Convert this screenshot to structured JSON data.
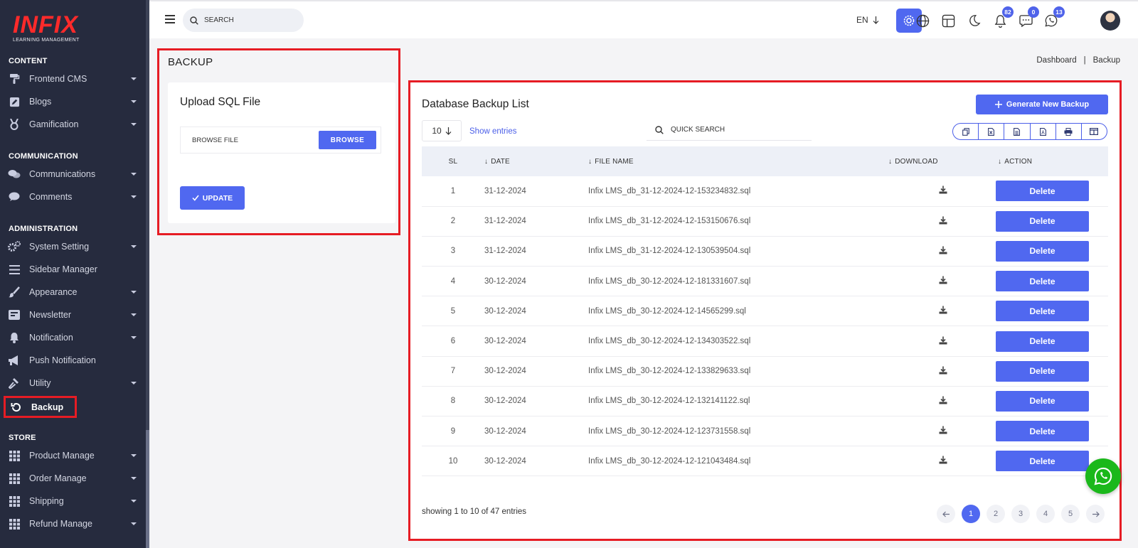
{
  "brand": {
    "name": "INFIX",
    "tagline": "LEARNING MANAGEMENT"
  },
  "sidebar": {
    "sections": [
      {
        "title": "CONTENT",
        "items": [
          {
            "label": "Frontend CMS",
            "icon": "paint-roller-icon",
            "has_caret": true
          },
          {
            "label": "Blogs",
            "icon": "pencil-square-icon",
            "has_caret": true
          },
          {
            "label": "Gamification",
            "icon": "medal-icon",
            "has_caret": true
          }
        ]
      },
      {
        "title": "COMMUNICATION",
        "items": [
          {
            "label": "Communications",
            "icon": "users-chat-icon",
            "has_caret": true
          },
          {
            "label": "Comments",
            "icon": "comment-icon",
            "has_caret": true
          }
        ]
      },
      {
        "title": "ADMINISTRATION",
        "items": [
          {
            "label": "System Setting",
            "icon": "gears-icon",
            "has_caret": true
          },
          {
            "label": "Sidebar Manager",
            "icon": "bars-icon",
            "has_caret": false
          },
          {
            "label": "Appearance",
            "icon": "brush-icon",
            "has_caret": true
          },
          {
            "label": "Newsletter",
            "icon": "newsletter-icon",
            "has_caret": true
          },
          {
            "label": "Notification",
            "icon": "bell-icon",
            "has_caret": true
          },
          {
            "label": "Push Notification",
            "icon": "megaphone-icon",
            "has_caret": false
          },
          {
            "label": "Utility",
            "icon": "hammer-icon",
            "has_caret": true
          },
          {
            "label": "Backup",
            "icon": "restore-icon",
            "has_caret": false,
            "active": true
          }
        ]
      },
      {
        "title": "STORE",
        "items": [
          {
            "label": "Product Manage",
            "icon": "grid-icon",
            "has_caret": true
          },
          {
            "label": "Order Manage",
            "icon": "grid-icon",
            "has_caret": true
          },
          {
            "label": "Shipping",
            "icon": "grid-icon",
            "has_caret": true
          },
          {
            "label": "Refund Manage",
            "icon": "grid-icon",
            "has_caret": true
          }
        ]
      }
    ]
  },
  "header": {
    "search_placeholder": "SEARCH",
    "language": "EN",
    "notification_count": "82",
    "message_count": "0",
    "whatsapp_count": "13"
  },
  "page": {
    "title": "BACKUP",
    "breadcrumb": [
      "Dashboard",
      "|",
      "Backup"
    ]
  },
  "upload": {
    "title": "Upload SQL File",
    "file_placeholder": "BROWSE FILE",
    "browse_label": "BROWSE",
    "update_label": "UPDATE"
  },
  "backup_list": {
    "title": "Database Backup List",
    "generate_label": "Generate New Backup",
    "page_length": "10",
    "show_entries_label": "Show entries",
    "search_placeholder": "QUICK SEARCH",
    "export_buttons": [
      "copy-icon",
      "excel-icon",
      "csv-icon",
      "pdf-icon",
      "print-icon",
      "columns-icon"
    ],
    "columns": [
      "SL",
      "DATE",
      "FILE NAME",
      "DOWNLOAD",
      "ACTION"
    ],
    "delete_label": "Delete",
    "rows": [
      {
        "sl": "1",
        "date": "31-12-2024",
        "file": "Infix LMS_db_31-12-2024-12-153234832.sql"
      },
      {
        "sl": "2",
        "date": "31-12-2024",
        "file": "Infix LMS_db_31-12-2024-12-153150676.sql"
      },
      {
        "sl": "3",
        "date": "31-12-2024",
        "file": "Infix LMS_db_31-12-2024-12-130539504.sql"
      },
      {
        "sl": "4",
        "date": "30-12-2024",
        "file": "Infix LMS_db_30-12-2024-12-181331607.sql"
      },
      {
        "sl": "5",
        "date": "30-12-2024",
        "file": "Infix LMS_db_30-12-2024-12-14565299.sql"
      },
      {
        "sl": "6",
        "date": "30-12-2024",
        "file": "Infix LMS_db_30-12-2024-12-134303522.sql"
      },
      {
        "sl": "7",
        "date": "30-12-2024",
        "file": "Infix LMS_db_30-12-2024-12-133829633.sql"
      },
      {
        "sl": "8",
        "date": "30-12-2024",
        "file": "Infix LMS_db_30-12-2024-12-132141122.sql"
      },
      {
        "sl": "9",
        "date": "30-12-2024",
        "file": "Infix LMS_db_30-12-2024-12-123731558.sql"
      },
      {
        "sl": "10",
        "date": "30-12-2024",
        "file": "Infix LMS_db_30-12-2024-12-121043484.sql"
      }
    ],
    "showing_text": "showing 1 to 10 of 47 entries",
    "pages": [
      "1",
      "2",
      "3",
      "4",
      "5"
    ],
    "current_page": "1"
  },
  "colors": {
    "accent": "#5068f0",
    "sidebar_bg": "#262b3e",
    "highlight": "#e61c24",
    "brand_red": "#ff2a2a",
    "whatsapp": "#1bb81b"
  }
}
